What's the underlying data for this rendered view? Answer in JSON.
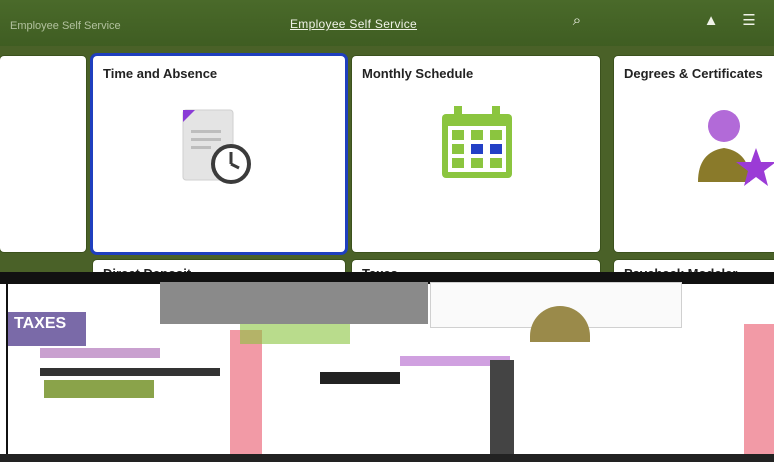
{
  "header": {
    "title": "Employee Self Service",
    "left_text": "Employee Self Service"
  },
  "tiles": [
    {
      "label": "Time and Absence"
    },
    {
      "label": "Monthly Schedule"
    },
    {
      "label": "Degrees & Certificates"
    },
    {
      "label": "Direct Deposit"
    },
    {
      "label": "Taxes"
    },
    {
      "label": "Paycheck Modeler"
    }
  ],
  "taxes_graphic": {
    "label": "TAXES"
  },
  "colors": {
    "header": "#3f5d22",
    "selected_border": "#1f3fbf",
    "calendar_green": "#8bc53f",
    "calendar_blue": "#2340c6",
    "accent_purple": "#9b3bd6"
  }
}
